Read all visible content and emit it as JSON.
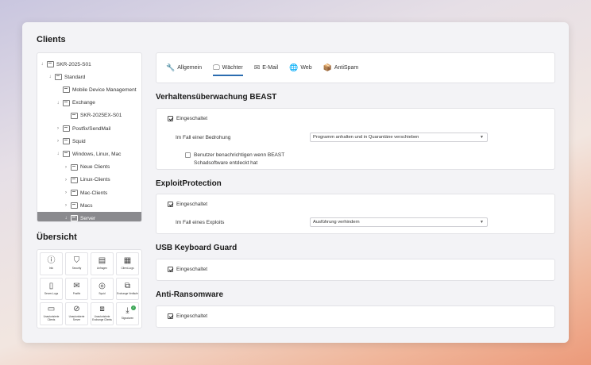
{
  "sidebar": {
    "clients_title": "Clients",
    "tree": [
      {
        "label": "SKR-2025-S01",
        "chev": "↓",
        "indent": 0
      },
      {
        "label": "Standard",
        "chev": "↓",
        "indent": 1
      },
      {
        "label": "Mobile Device Management",
        "chev": "",
        "indent": 2
      },
      {
        "label": "Exchange",
        "chev": "↓",
        "indent": 2
      },
      {
        "label": "SKR-2025EX-S01",
        "chev": "",
        "indent": 3
      },
      {
        "label": "Postfix/SendMail",
        "chev": "›",
        "indent": 2
      },
      {
        "label": "Squid",
        "chev": "›",
        "indent": 2
      },
      {
        "label": "Windows, Linux, Mac",
        "chev": "↓",
        "indent": 2
      },
      {
        "label": "Neue Clients",
        "chev": "›",
        "indent": 3
      },
      {
        "label": "Linux-Clients",
        "chev": "›",
        "indent": 3
      },
      {
        "label": "Mac-Clients",
        "chev": "›",
        "indent": 3
      },
      {
        "label": "Macs",
        "chev": "›",
        "indent": 3
      },
      {
        "label": "Server",
        "chev": "↓",
        "indent": 3,
        "selected": true
      }
    ],
    "overview_title": "Übersicht",
    "tiles": [
      {
        "label": "Info",
        "icon": "ⓘ"
      },
      {
        "label": "Security",
        "icon": "⛉"
      },
      {
        "label": "Anfragen",
        "icon": "▤"
      },
      {
        "label": "Client-Logs",
        "icon": "▦"
      },
      {
        "label": "Server-Logs",
        "icon": "▯"
      },
      {
        "label": "Postfix",
        "icon": "✉"
      },
      {
        "label": "Squid",
        "icon": "◎"
      },
      {
        "label": "Exchange Verläufe",
        "icon": "⧉"
      },
      {
        "label": "Unautorisierte Clients",
        "icon": "▭"
      },
      {
        "label": "Unautorisierte Server",
        "icon": "⊘"
      },
      {
        "label": "Unautorisierte Exchange Clients",
        "icon": "⧈"
      },
      {
        "label": "Signaturen",
        "icon": "⤓",
        "badge": "✓"
      }
    ]
  },
  "tabs": [
    {
      "label": "Allgemein",
      "icon": "🔧",
      "active": false
    },
    {
      "label": "Wächter",
      "icon": "🖵",
      "active": true
    },
    {
      "label": "E-Mail",
      "icon": "✉",
      "active": false
    },
    {
      "label": "Web",
      "icon": "🌐",
      "active": false
    },
    {
      "label": "AntiSpam",
      "icon": "📦",
      "active": false
    }
  ],
  "beast": {
    "title": "Verhaltensüberwachung BEAST",
    "enabled_label": "Eingeschaltet",
    "threat_label": "Im Fall einer Bedrohung",
    "threat_value": "Programm anhalten und in Quarantäne verschieben",
    "notify_label": "Benutzer benachrichtigen wenn BEAST Schadsoftware entdeckt hat"
  },
  "exploit": {
    "title": "ExploitProtection",
    "enabled_label": "Eingeschaltet",
    "case_label": "Im Fall eines Exploits",
    "case_value": "Ausführung verhindern"
  },
  "usb": {
    "title": "USB Keyboard Guard",
    "enabled_label": "Eingeschaltet"
  },
  "ransom": {
    "title": "Anti-Ransomware",
    "enabled_label": "Eingeschaltet"
  },
  "colors": {
    "accent": "#2b6cb0",
    "selected": "#8a8a8e"
  }
}
